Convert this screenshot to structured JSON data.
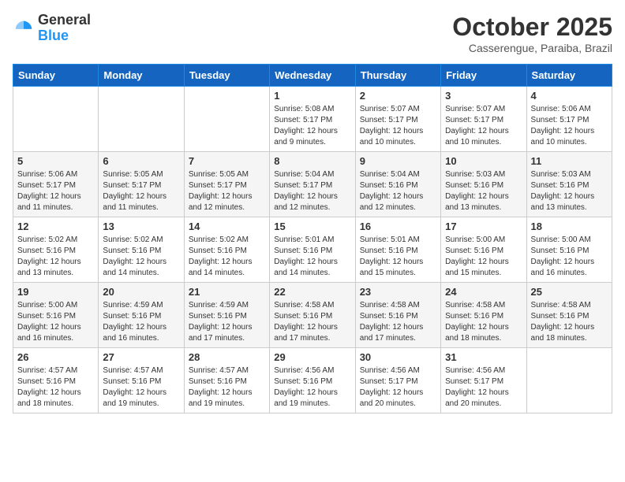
{
  "header": {
    "logo_general": "General",
    "logo_blue": "Blue",
    "month_title": "October 2025",
    "location": "Casserengue, Paraiba, Brazil"
  },
  "weekdays": [
    "Sunday",
    "Monday",
    "Tuesday",
    "Wednesday",
    "Thursday",
    "Friday",
    "Saturday"
  ],
  "weeks": [
    [
      {
        "day": "",
        "info": ""
      },
      {
        "day": "",
        "info": ""
      },
      {
        "day": "",
        "info": ""
      },
      {
        "day": "1",
        "info": "Sunrise: 5:08 AM\nSunset: 5:17 PM\nDaylight: 12 hours\nand 9 minutes."
      },
      {
        "day": "2",
        "info": "Sunrise: 5:07 AM\nSunset: 5:17 PM\nDaylight: 12 hours\nand 10 minutes."
      },
      {
        "day": "3",
        "info": "Sunrise: 5:07 AM\nSunset: 5:17 PM\nDaylight: 12 hours\nand 10 minutes."
      },
      {
        "day": "4",
        "info": "Sunrise: 5:06 AM\nSunset: 5:17 PM\nDaylight: 12 hours\nand 10 minutes."
      }
    ],
    [
      {
        "day": "5",
        "info": "Sunrise: 5:06 AM\nSunset: 5:17 PM\nDaylight: 12 hours\nand 11 minutes."
      },
      {
        "day": "6",
        "info": "Sunrise: 5:05 AM\nSunset: 5:17 PM\nDaylight: 12 hours\nand 11 minutes."
      },
      {
        "day": "7",
        "info": "Sunrise: 5:05 AM\nSunset: 5:17 PM\nDaylight: 12 hours\nand 12 minutes."
      },
      {
        "day": "8",
        "info": "Sunrise: 5:04 AM\nSunset: 5:17 PM\nDaylight: 12 hours\nand 12 minutes."
      },
      {
        "day": "9",
        "info": "Sunrise: 5:04 AM\nSunset: 5:16 PM\nDaylight: 12 hours\nand 12 minutes."
      },
      {
        "day": "10",
        "info": "Sunrise: 5:03 AM\nSunset: 5:16 PM\nDaylight: 12 hours\nand 13 minutes."
      },
      {
        "day": "11",
        "info": "Sunrise: 5:03 AM\nSunset: 5:16 PM\nDaylight: 12 hours\nand 13 minutes."
      }
    ],
    [
      {
        "day": "12",
        "info": "Sunrise: 5:02 AM\nSunset: 5:16 PM\nDaylight: 12 hours\nand 13 minutes."
      },
      {
        "day": "13",
        "info": "Sunrise: 5:02 AM\nSunset: 5:16 PM\nDaylight: 12 hours\nand 14 minutes."
      },
      {
        "day": "14",
        "info": "Sunrise: 5:02 AM\nSunset: 5:16 PM\nDaylight: 12 hours\nand 14 minutes."
      },
      {
        "day": "15",
        "info": "Sunrise: 5:01 AM\nSunset: 5:16 PM\nDaylight: 12 hours\nand 14 minutes."
      },
      {
        "day": "16",
        "info": "Sunrise: 5:01 AM\nSunset: 5:16 PM\nDaylight: 12 hours\nand 15 minutes."
      },
      {
        "day": "17",
        "info": "Sunrise: 5:00 AM\nSunset: 5:16 PM\nDaylight: 12 hours\nand 15 minutes."
      },
      {
        "day": "18",
        "info": "Sunrise: 5:00 AM\nSunset: 5:16 PM\nDaylight: 12 hours\nand 16 minutes."
      }
    ],
    [
      {
        "day": "19",
        "info": "Sunrise: 5:00 AM\nSunset: 5:16 PM\nDaylight: 12 hours\nand 16 minutes."
      },
      {
        "day": "20",
        "info": "Sunrise: 4:59 AM\nSunset: 5:16 PM\nDaylight: 12 hours\nand 16 minutes."
      },
      {
        "day": "21",
        "info": "Sunrise: 4:59 AM\nSunset: 5:16 PM\nDaylight: 12 hours\nand 17 minutes."
      },
      {
        "day": "22",
        "info": "Sunrise: 4:58 AM\nSunset: 5:16 PM\nDaylight: 12 hours\nand 17 minutes."
      },
      {
        "day": "23",
        "info": "Sunrise: 4:58 AM\nSunset: 5:16 PM\nDaylight: 12 hours\nand 17 minutes."
      },
      {
        "day": "24",
        "info": "Sunrise: 4:58 AM\nSunset: 5:16 PM\nDaylight: 12 hours\nand 18 minutes."
      },
      {
        "day": "25",
        "info": "Sunrise: 4:58 AM\nSunset: 5:16 PM\nDaylight: 12 hours\nand 18 minutes."
      }
    ],
    [
      {
        "day": "26",
        "info": "Sunrise: 4:57 AM\nSunset: 5:16 PM\nDaylight: 12 hours\nand 18 minutes."
      },
      {
        "day": "27",
        "info": "Sunrise: 4:57 AM\nSunset: 5:16 PM\nDaylight: 12 hours\nand 19 minutes."
      },
      {
        "day": "28",
        "info": "Sunrise: 4:57 AM\nSunset: 5:16 PM\nDaylight: 12 hours\nand 19 minutes."
      },
      {
        "day": "29",
        "info": "Sunrise: 4:56 AM\nSunset: 5:16 PM\nDaylight: 12 hours\nand 19 minutes."
      },
      {
        "day": "30",
        "info": "Sunrise: 4:56 AM\nSunset: 5:17 PM\nDaylight: 12 hours\nand 20 minutes."
      },
      {
        "day": "31",
        "info": "Sunrise: 4:56 AM\nSunset: 5:17 PM\nDaylight: 12 hours\nand 20 minutes."
      },
      {
        "day": "",
        "info": ""
      }
    ]
  ]
}
